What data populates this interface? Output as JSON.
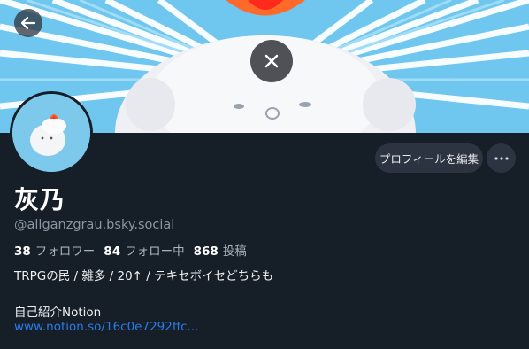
{
  "profile": {
    "display_name": "灰乃",
    "handle": "@allganzgrau.bsky.social",
    "followers_count": "38",
    "followers_label": "フォロワー",
    "following_count": "84",
    "following_label": "フォロー中",
    "posts_count": "868",
    "posts_label": "投稿",
    "bio_line1": "TRPGの民 / 雑多 / 20↑ / テキセボイセどちらも",
    "bio_line2": "自己紹介Notion",
    "bio_link": "www.notion.so/16c0e7292ffc..."
  },
  "actions": {
    "edit_profile_label": "プロフィールを編集"
  },
  "icons": {
    "back": "arrow-left-icon",
    "close": "close-icon",
    "more": "more-horizontal-icon"
  },
  "colors": {
    "background": "#161e27",
    "link": "#2a7ce8",
    "banner_sky": "#6fc6ee"
  }
}
